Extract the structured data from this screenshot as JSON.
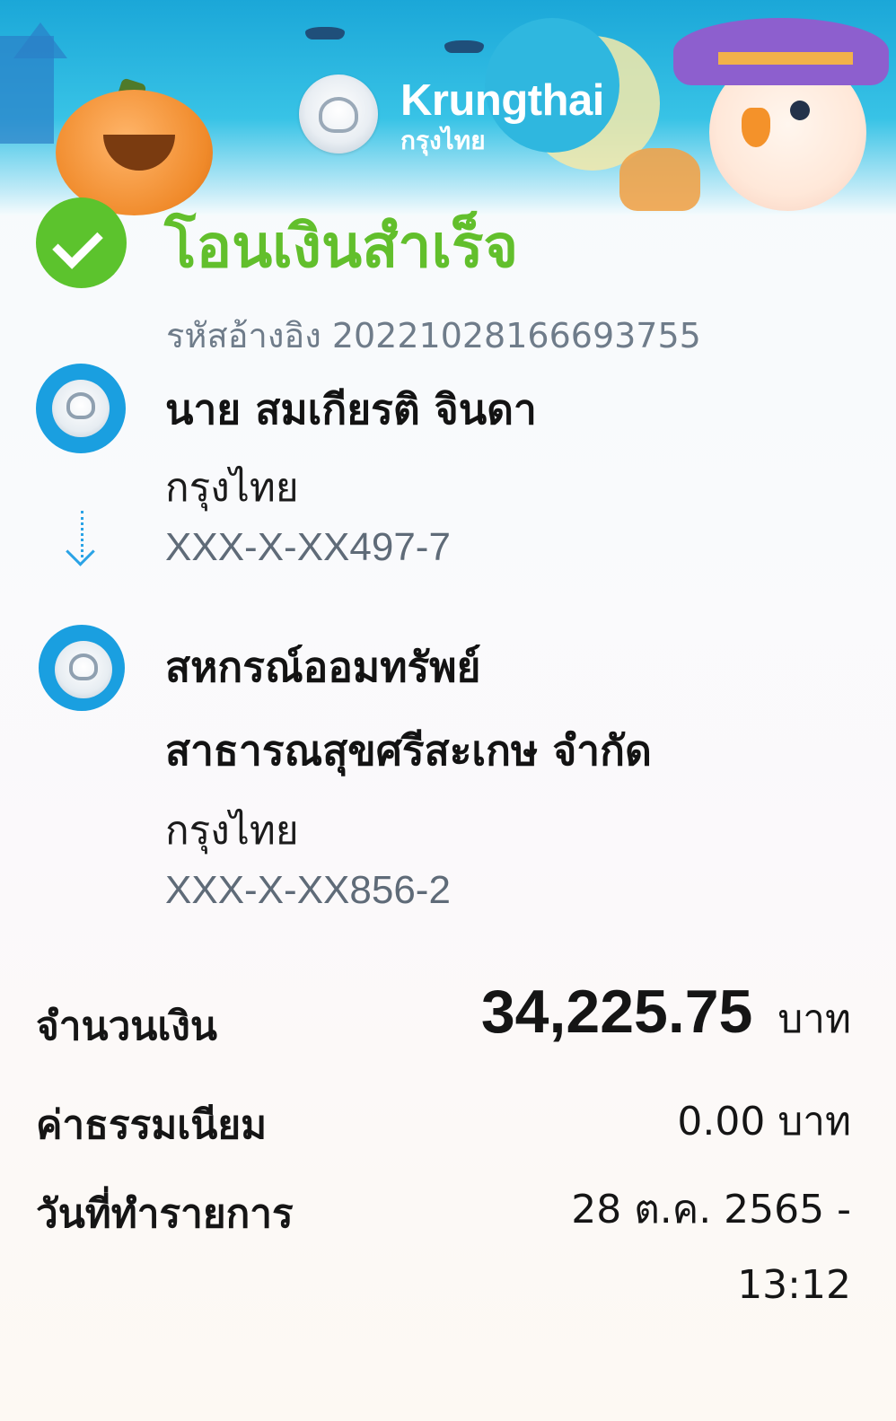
{
  "header": {
    "brand_en": "Krungthai",
    "brand_th": "กรุงไทย"
  },
  "status": {
    "title": "โอนเงินสำเร็จ",
    "reference": "รหัสอ้างอิง 20221028166693755"
  },
  "sender": {
    "name": "นาย สมเกียรติ จินดา",
    "bank": "กรุงไทย",
    "account": "XXX-X-XX497-7"
  },
  "receiver": {
    "name_line1": "สหกรณ์ออมทรัพย์",
    "name_line2": "สาธารณสุขศรีสะเกษ จำกัด",
    "bank": "กรุงไทย",
    "account": "XXX-X-XX856-2"
  },
  "details": {
    "amount_label": "จำนวนเงิน",
    "amount_value": "34,225.75",
    "amount_unit": "บาท",
    "fee_label": "ค่าธรรมเนียม",
    "fee_value": "0.00 บาท",
    "date_label": "วันที่ทำรายการ",
    "date_value": "28 ต.ค. 2565 -",
    "time_value": "13:12"
  },
  "colors": {
    "success": "#62bf2c",
    "bank_blue": "#1a9fe0"
  }
}
